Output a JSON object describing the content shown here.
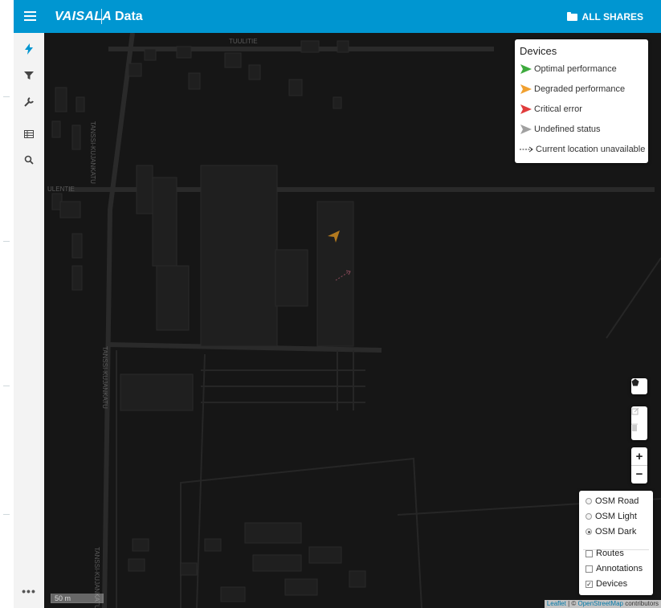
{
  "header": {
    "brand": "VAISALA",
    "title": "Data",
    "shares_label": "ALL SHARES",
    "color": "#0096d1"
  },
  "sidebar": {
    "items": [
      {
        "name": "lightning-icon"
      },
      {
        "name": "filter-icon"
      },
      {
        "name": "wrench-icon"
      },
      {
        "name": "table-icon"
      },
      {
        "name": "search-icon"
      }
    ],
    "more_label": "•••"
  },
  "legend": {
    "title": "Devices",
    "items": [
      {
        "label": "Optimal performance",
        "color": "#3daa3d"
      },
      {
        "label": "Degraded performance",
        "color": "#f0a030"
      },
      {
        "label": "Critical error",
        "color": "#e03c3c"
      },
      {
        "label": "Undefined status",
        "color": "#a0a0a0"
      },
      {
        "label": "Current location unavailable",
        "color": "#333333"
      }
    ]
  },
  "layers": {
    "base": [
      {
        "label": "OSM Road",
        "selected": false
      },
      {
        "label": "OSM Light",
        "selected": false
      },
      {
        "label": "OSM Dark",
        "selected": true
      }
    ],
    "overlays": [
      {
        "label": "Routes",
        "checked": false
      },
      {
        "label": "Annotations",
        "checked": false
      },
      {
        "label": "Devices",
        "checked": true
      }
    ]
  },
  "map": {
    "scale_label": "50 m",
    "attribution_leaflet": "Leaflet",
    "attribution_sep": " | © ",
    "attribution_osm": "OpenStreetMap",
    "attribution_tail": " contributors",
    "streets": [
      "TUULITIE",
      "ULENTIE",
      "TANSSI-KUJANKATU",
      "TANSSI-KUJANKATU",
      "TANSSI-KUJANKATU"
    ]
  },
  "controls": {
    "zoom_in": "+",
    "zoom_out": "−"
  }
}
